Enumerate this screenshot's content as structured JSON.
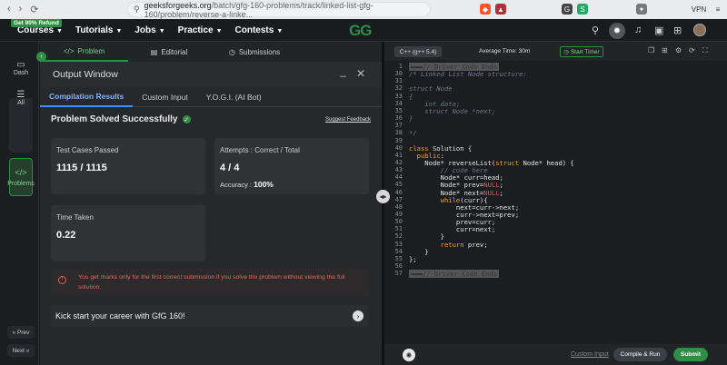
{
  "browser": {
    "url_host": "geeksforgeeks.org",
    "url_path": "/batch/gfg-160-problems/track/linked-list-gfg-160/problem/reverse-a-linke...",
    "vpn_label": "VPN"
  },
  "header": {
    "refund_badge": "Get 90% Refund",
    "menu": [
      "Courses",
      "Tutorials",
      "Jobs",
      "Practice",
      "Contests"
    ],
    "logo": "GG"
  },
  "rail": {
    "dash": "Dash",
    "all": "All",
    "problems": "Problems",
    "prev": "« Prev",
    "next": "Next »"
  },
  "problem_tabs": [
    "Problem",
    "Editorial",
    "Submissions"
  ],
  "output": {
    "title": "Output Window",
    "minimize": "_",
    "close": "✕",
    "tabs": [
      "Compilation Results",
      "Custom Input",
      "Y.O.G.I. (AI Bot)"
    ],
    "status": "Problem Solved Successfully",
    "feedback": "Suggest Feedback",
    "test_cases_label": "Test Cases Passed",
    "test_cases_value": "1115 / 1115",
    "attempts_label": "Attempts : Correct / Total",
    "attempts_value": "4 / 4",
    "accuracy_label": "Accuracy :",
    "accuracy_value": "100%",
    "time_label": "Time Taken",
    "time_value": "0.22",
    "warning": "You get marks only for the first correct submission if you solve the problem without viewing the full solution.",
    "kickstart": "Kick start your career with GfG 160!"
  },
  "editor": {
    "language": "C++ (g++ 5.4)",
    "avg_time": "Average Time: 30m",
    "timer": "Start Timer",
    "custom_input": "Custom Input",
    "compile_run": "Compile & Run",
    "submit": "Submit",
    "line_numbers": [
      "1",
      "30",
      "31",
      "32",
      "33",
      "34",
      "35",
      "36",
      "37",
      "38",
      "39",
      "40",
      "41",
      "42",
      "43",
      "44",
      "45",
      "46",
      "47",
      "48",
      "49",
      "50",
      "51",
      "52",
      "53",
      "54",
      "55",
      "56",
      "57"
    ],
    "lines": [
      "▬▬▬// Driver Code Ends",
      "/* Linked List Node structure:",
      "",
      "struct Node",
      "{",
      "    int data;",
      "    struct Node *next;",
      "}",
      "",
      "*/",
      "",
      "class Solution {",
      "  public:",
      "    Node* reverseList(struct Node* head) {",
      "        // code here",
      "        Node* curr=head;",
      "        Node* prev=NULL;",
      "        Node* next=NULL;",
      "        while(curr){",
      "            next=curr->next;",
      "            curr->next=prev;",
      "            prev=curr;",
      "            curr=next;",
      "        }",
      "        return prev;",
      "    }",
      "};",
      "",
      "▬▬▬// Driver Code Ends"
    ]
  }
}
